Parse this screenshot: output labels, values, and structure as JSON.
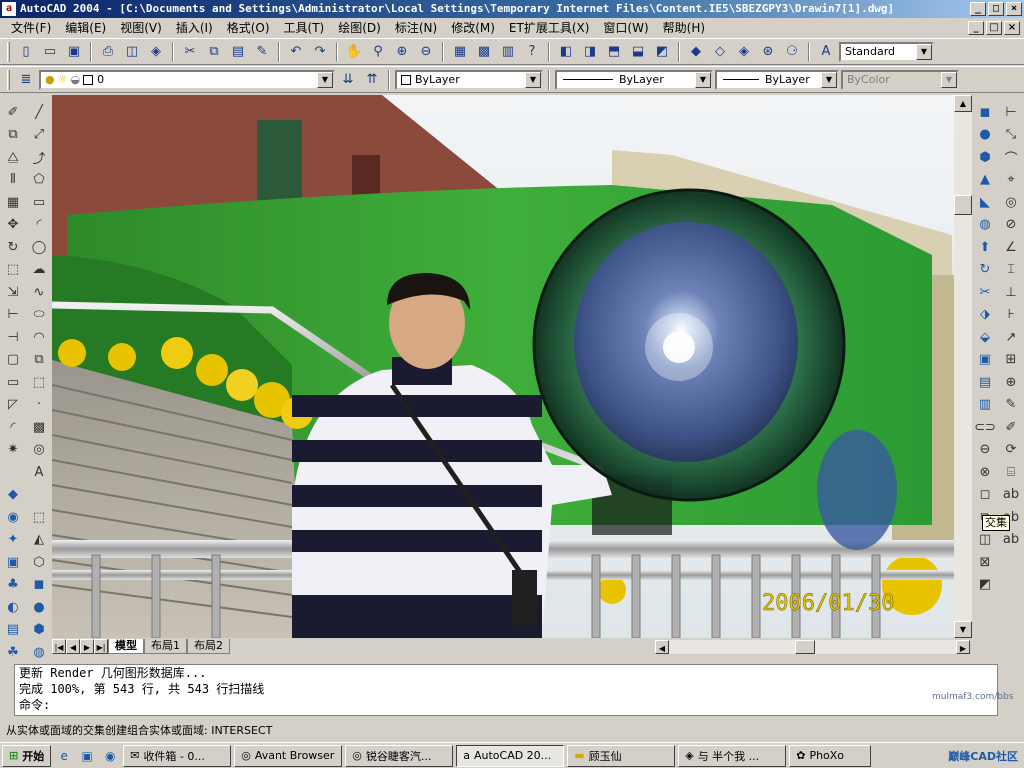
{
  "window": {
    "title": "AutoCAD 2004 - [C:\\Documents and Settings\\Administrator\\Local Settings\\Temporary Internet Files\\Content.IE5\\SBEZGPY3\\Drawin7[1].dwg]",
    "app_icon": "autocad-icon",
    "controls": [
      "_",
      "□",
      "×"
    ]
  },
  "menu": {
    "items": [
      "文件(F)",
      "编辑(E)",
      "视图(V)",
      "插入(I)",
      "格式(O)",
      "工具(T)",
      "绘图(D)",
      "标注(N)",
      "修改(M)",
      "ET扩展工具(X)",
      "窗口(W)",
      "帮助(H)"
    ],
    "doc_controls": [
      "_",
      "□",
      "×"
    ]
  },
  "toolbar1": {
    "icons": [
      "new-icon",
      "open-icon",
      "save-icon",
      "print-icon",
      "preview-icon",
      "publish-icon",
      "cut-icon",
      "copy-icon",
      "paste-icon",
      "match-icon",
      "undo-icon",
      "redo-icon",
      "pan-icon",
      "zoom-icon",
      "zoom-window-icon",
      "zoom-prev-icon",
      "properties-icon",
      "designcenter-icon",
      "toolpalette-icon",
      "help-icon",
      "view-top-icon",
      "view-front-icon",
      "view-iso-icon",
      "view-sw-icon",
      "view-se-icon",
      "shade-icon",
      "flat-icon",
      "gouraud-icon",
      "3dorbit-icon",
      "camera-icon",
      "textstyle-icon"
    ],
    "text_style": "Standard"
  },
  "toolbar2": {
    "layer": "0",
    "color": "ByLayer",
    "linetype": "ByLayer",
    "lineweight": "ByLayer",
    "plotstyle": "ByColor"
  },
  "tabs": {
    "model": "模型",
    "layout1": "布局1",
    "layout2": "布局2"
  },
  "drawing": {
    "timestamp": "2006/01/30"
  },
  "tooltip": "交集",
  "command": {
    "lines": [
      "更新 Render 几何图形数据库...",
      "完成 100%, 第 543 行, 共 543 行扫描线"
    ],
    "prompt": "命令:",
    "watermark": "mulmaf3.com/bbs"
  },
  "status": {
    "text": "从实体或面域的交集创建组合实体或面域:   INTERSECT"
  },
  "taskbar": {
    "start": "开始",
    "tasks": [
      "收件箱 - 0...",
      "Avant Browser",
      "锐谷睫客汽...",
      "AutoCAD 20...",
      "顾玉仙",
      "与 半个我 ...",
      "PhoXo"
    ],
    "tray_text": "巅峰CAD社区"
  }
}
